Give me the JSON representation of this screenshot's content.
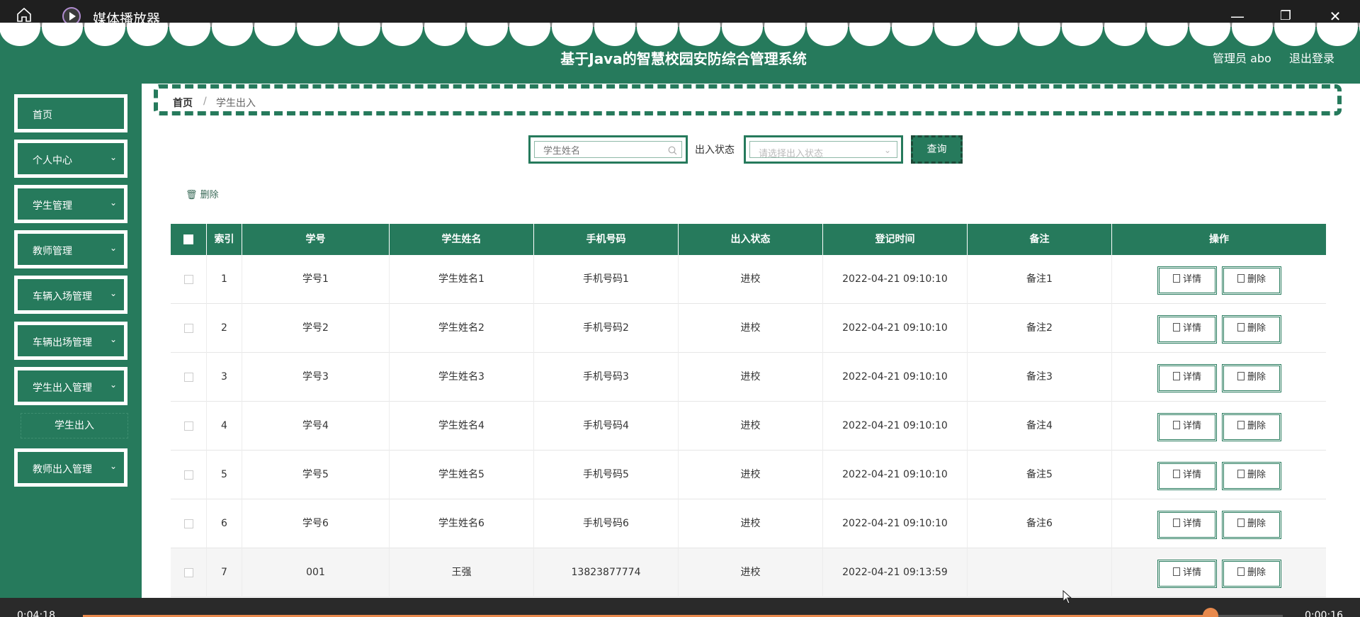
{
  "window": {
    "title": "媒体播放器"
  },
  "header": {
    "system_title": "基于Java的智慧校园安防综合管理系统",
    "admin": "管理员 abo",
    "logout": "退出登录"
  },
  "sidebar": {
    "items": [
      {
        "label": "首页",
        "has_arrow": false
      },
      {
        "label": "个人中心",
        "has_arrow": true
      },
      {
        "label": "学生管理",
        "has_arrow": true
      },
      {
        "label": "教师管理",
        "has_arrow": true
      },
      {
        "label": "车辆入场管理",
        "has_arrow": true
      },
      {
        "label": "车辆出场管理",
        "has_arrow": true
      },
      {
        "label": "学生出入管理",
        "has_arrow": true
      },
      {
        "label": "教师出入管理",
        "has_arrow": true
      }
    ],
    "submenu": {
      "label": "学生出入"
    }
  },
  "breadcrumb": {
    "home": "首页",
    "separator": "/",
    "current": "学生出入"
  },
  "search": {
    "name_placeholder": "学生姓名",
    "status_label": "出入状态",
    "status_placeholder": "请选择出入状态",
    "query_label": "查询"
  },
  "toolbar": {
    "delete_label": "删除"
  },
  "table": {
    "headers": [
      "索引",
      "学号",
      "学生姓名",
      "手机号码",
      "出入状态",
      "登记时间",
      "备注",
      "操作"
    ],
    "rows": [
      {
        "index": "1",
        "id": "学号1",
        "name": "学生姓名1",
        "phone": "手机号码1",
        "status": "进校",
        "time": "2022-04-21 09:10:10",
        "note": "备注1"
      },
      {
        "index": "2",
        "id": "学号2",
        "name": "学生姓名2",
        "phone": "手机号码2",
        "status": "进校",
        "time": "2022-04-21 09:10:10",
        "note": "备注2"
      },
      {
        "index": "3",
        "id": "学号3",
        "name": "学生姓名3",
        "phone": "手机号码3",
        "status": "进校",
        "time": "2022-04-21 09:10:10",
        "note": "备注3"
      },
      {
        "index": "4",
        "id": "学号4",
        "name": "学生姓名4",
        "phone": "手机号码4",
        "status": "进校",
        "time": "2022-04-21 09:10:10",
        "note": "备注4"
      },
      {
        "index": "5",
        "id": "学号5",
        "name": "学生姓名5",
        "phone": "手机号码5",
        "status": "进校",
        "time": "2022-04-21 09:10:10",
        "note": "备注5"
      },
      {
        "index": "6",
        "id": "学号6",
        "name": "学生姓名6",
        "phone": "手机号码6",
        "status": "进校",
        "time": "2022-04-21 09:10:10",
        "note": "备注6"
      },
      {
        "index": "7",
        "id": "001",
        "name": "王强",
        "phone": "13823877774",
        "status": "进校",
        "time": "2022-04-21 09:13:59",
        "note": ""
      }
    ],
    "detail_label": "详情",
    "delete_label": "删除"
  },
  "media": {
    "elapsed": "0:04:18",
    "remaining": "0:00:16",
    "progress": 0.94
  },
  "colors": {
    "theme": "#267a5c",
    "titlebar": "#1f1f1f",
    "progress": "#e8894c"
  }
}
